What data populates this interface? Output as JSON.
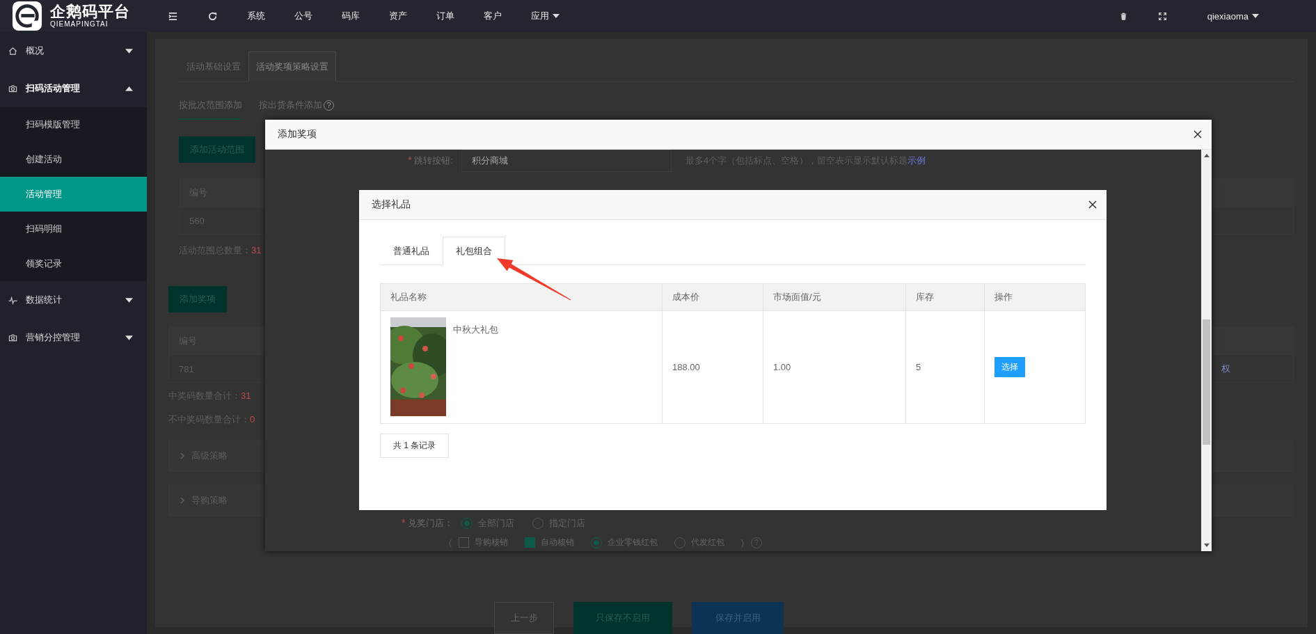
{
  "logo": {
    "name": "企鹅码平台",
    "subtitle": "QIEMAPINGTAI"
  },
  "top_nav": [
    {
      "label": "系统",
      "has_menu": false
    },
    {
      "label": "公号",
      "has_menu": false
    },
    {
      "label": "码库",
      "has_menu": false
    },
    {
      "label": "资产",
      "has_menu": false
    },
    {
      "label": "订单",
      "has_menu": false
    },
    {
      "label": "客户",
      "has_menu": false
    },
    {
      "label": "应用",
      "has_menu": true
    }
  ],
  "user": {
    "name": "qiexiaoma"
  },
  "sidebar": {
    "items": [
      {
        "label": "概况",
        "expanded": false
      },
      {
        "label": "扫码活动管理",
        "expanded": true,
        "children": [
          {
            "label": "扫码模版管理",
            "selected": false
          },
          {
            "label": "创建活动",
            "selected": false
          },
          {
            "label": "活动管理",
            "selected": true
          },
          {
            "label": "扫码明细",
            "selected": false
          },
          {
            "label": "领奖记录",
            "selected": false
          }
        ]
      },
      {
        "label": "数据统计",
        "expanded": false
      },
      {
        "label": "营销分控管理",
        "expanded": false
      }
    ]
  },
  "page": {
    "tabs": [
      {
        "label": "活动基础设置",
        "selected": false
      },
      {
        "label": "活动奖项策略设置",
        "selected": true
      }
    ],
    "sub_tabs": [
      {
        "label": "按批次范围添加",
        "selected": true
      },
      {
        "label": "按出货条件添加",
        "selected": false,
        "help": "?"
      }
    ],
    "add_range_button": "添加活动范围",
    "range_table": {
      "columns": [
        "编号"
      ],
      "rows": [
        [
          "560"
        ]
      ]
    },
    "range_total": {
      "label": "活动范围总数量：",
      "value": "31"
    },
    "add_prize_button": "添加奖项",
    "prize_table": {
      "columns": [
        "编号"
      ],
      "rows": [
        {
          "id": "781",
          "column_last": "权"
        }
      ]
    },
    "win_count": {
      "label": "中奖码数量合计：",
      "value": "31"
    },
    "lose_count": {
      "label": "不中奖码数量合计：",
      "value": "0"
    },
    "panels": [
      {
        "label": "高级策略",
        "expanded": false
      },
      {
        "label": "导购策略",
        "expanded": false
      }
    ],
    "footer_buttons": [
      {
        "label": "上一步",
        "kind": "default"
      },
      {
        "label": "只保存不启用",
        "kind": "teal"
      },
      {
        "label": "保存并启用",
        "kind": "blue"
      }
    ]
  },
  "prize_dialog": {
    "title": "添加奖项",
    "jump_field": {
      "required_mark": "*",
      "label": "跳转按钮:",
      "value": "积分商城",
      "hint": "最多4个字（包括标点、空格），留空表示显示默认标题",
      "hint_link": "示例"
    },
    "store_field": {
      "required_mark": "*",
      "label": "兑奖门店：",
      "options": [
        {
          "label": "全部门店",
          "selected": true
        },
        {
          "label": "指定门店",
          "selected": false
        }
      ]
    },
    "options_row": {
      "open": "(",
      "close": ")",
      "help": "?",
      "items": [
        {
          "kind": "checkbox",
          "label": "导购核销",
          "checked": false
        },
        {
          "kind": "checkbox",
          "label": "自动核销",
          "checked": true
        },
        {
          "kind": "radio",
          "label": "企业零钱红包",
          "checked": true
        },
        {
          "kind": "radio",
          "label": "代发红包",
          "checked": false
        }
      ]
    }
  },
  "gift_dialog": {
    "title": "选择礼品",
    "tabs": [
      {
        "label": "普通礼品",
        "selected": false
      },
      {
        "label": "礼包组合",
        "selected": true
      }
    ],
    "table": {
      "columns": [
        "礼品名称",
        "成本价",
        "市场面值/元",
        "库存",
        "操作"
      ],
      "rows": [
        {
          "name": "中秋大礼包",
          "cost": "188.00",
          "market": "1.00",
          "stock": "5",
          "action": "选择"
        }
      ]
    },
    "total": "共 1 条记录"
  }
}
